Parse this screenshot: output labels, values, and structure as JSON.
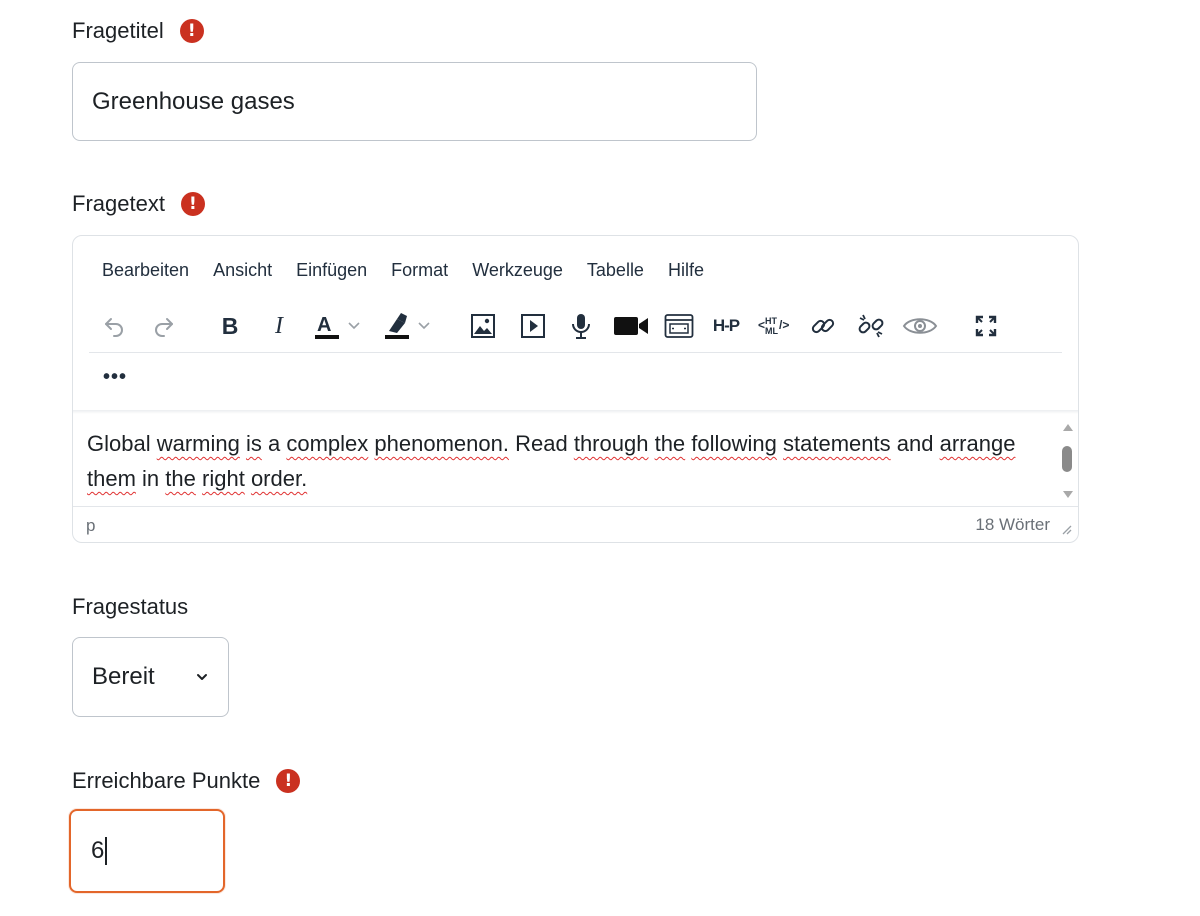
{
  "title_field": {
    "label": "Fragetitel",
    "required_icon": "exclamation-circle-icon",
    "value": "Greenhouse gases"
  },
  "text_field": {
    "label": "Fragetext",
    "required_icon": "exclamation-circle-icon",
    "menu": [
      "Bearbeiten",
      "Ansicht",
      "Einfügen",
      "Format",
      "Werkzeuge",
      "Tabelle",
      "Hilfe"
    ],
    "toolbar_icons": [
      "undo-icon",
      "redo-icon",
      "bold-icon",
      "italic-icon",
      "text-color-icon",
      "highlight-color-icon",
      "image-icon",
      "media-icon",
      "record-audio-icon",
      "record-video-icon",
      "embed-icon",
      "h5p-icon",
      "html-icon",
      "link-icon",
      "unlink-icon",
      "preview-icon",
      "fullscreen-icon"
    ],
    "more_label": "•••",
    "content_words": [
      "Global",
      "warming",
      "is",
      "a",
      "complex",
      "phenomenon.",
      "Read",
      "through",
      "the",
      "following",
      "statements",
      "and",
      "arrange",
      "them",
      "in",
      "the",
      "right",
      "order."
    ],
    "status_path": "p",
    "word_count": "18 Wörter"
  },
  "status_field": {
    "label": "Fragestatus",
    "selected": "Bereit"
  },
  "points_field": {
    "label": "Erreichbare Punkte",
    "required_icon": "exclamation-circle-icon",
    "value": "6"
  },
  "colors": {
    "required": "#ca3120",
    "focus_border": "#e3662a",
    "spellcheck": "#e03131"
  }
}
